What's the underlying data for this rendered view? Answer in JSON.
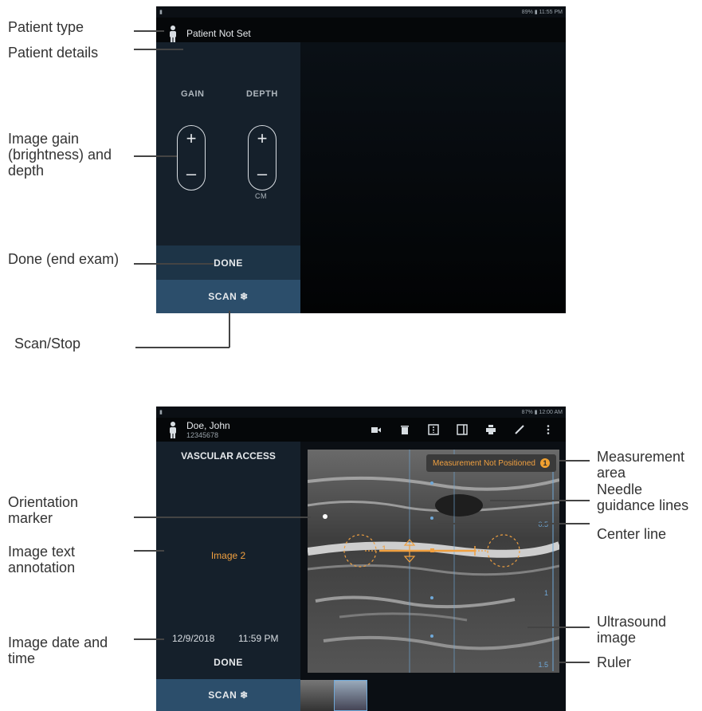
{
  "top_screen": {
    "status": "89% ▮ 11:55 PM",
    "patient_name": "Patient Not Set",
    "controls": {
      "gain_label": "GAIN",
      "depth_label": "DEPTH",
      "plus": "+",
      "minus": "–",
      "unit": "CM"
    },
    "done_label": "DONE",
    "scan_label": "SCAN ❄"
  },
  "bottom_screen": {
    "status": "87% ▮ 12:00 AM",
    "patient_name": "Doe, John",
    "patient_id": "12345678",
    "preset": "VASCULAR ACCESS",
    "annotation": "Image 2",
    "date": "12/9/2018",
    "time": "11:59 PM",
    "done_label": "DONE",
    "scan_label": "SCAN ❄",
    "measurement_badge": "Measurement Not Positioned",
    "measurement_badge_count": "1",
    "caliper_label": "1",
    "ruler_ticks": [
      "0.5",
      "1",
      "1.5"
    ],
    "toolbar_icons": [
      "video-icon",
      "trash-icon",
      "split-view-icon",
      "single-view-icon",
      "print-icon",
      "pencil-icon",
      "more-icon"
    ]
  },
  "callouts": {
    "patient_type": "Patient type",
    "patient_details": "Patient details",
    "gain_depth": "Image gain (brightness) and depth",
    "done": "Done (end exam)",
    "scan_stop": "Scan/Stop",
    "orientation_marker": "Orientation marker",
    "text_annotation": "Image text annotation",
    "date_time": "Image date and time",
    "measurement_area": "Measurement area",
    "needle_guidance": "Needle guidance lines",
    "center_line": "Center line",
    "ultrasound_image": "Ultrasound image",
    "ruler": "Ruler"
  },
  "colors": {
    "accent_orange": "#f0a040",
    "panel": "#15202b",
    "scan": "#2c4e6b",
    "done": "#1d3447",
    "guide_blue": "#6fa8d8"
  }
}
